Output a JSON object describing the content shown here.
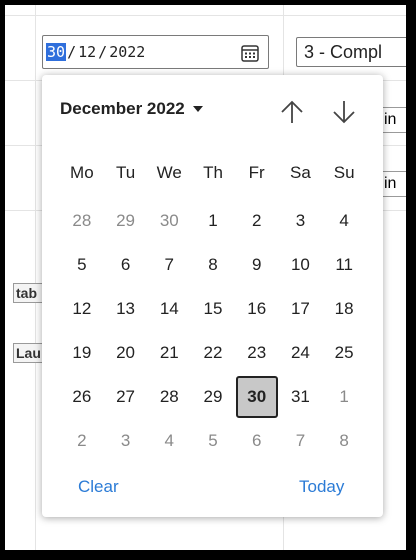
{
  "date_input": {
    "day": "30",
    "sep1": "/",
    "month": "12",
    "sep2": "/",
    "year": "2022"
  },
  "status_select": {
    "value": "3 - Compl"
  },
  "row_fields": [
    {
      "text": "in"
    },
    {
      "text": "in"
    }
  ],
  "side_buttons": [
    {
      "label": "tab"
    },
    {
      "label": "Lau"
    }
  ],
  "calendar": {
    "month_label": "December 2022",
    "weekdays": [
      "Mo",
      "Tu",
      "We",
      "Th",
      "Fr",
      "Sa",
      "Su"
    ],
    "days": [
      {
        "label": "28",
        "other": true
      },
      {
        "label": "29",
        "other": true
      },
      {
        "label": "30",
        "other": true
      },
      {
        "label": "1"
      },
      {
        "label": "2"
      },
      {
        "label": "3"
      },
      {
        "label": "4"
      },
      {
        "label": "5"
      },
      {
        "label": "6"
      },
      {
        "label": "7"
      },
      {
        "label": "8"
      },
      {
        "label": "9"
      },
      {
        "label": "10"
      },
      {
        "label": "11"
      },
      {
        "label": "12"
      },
      {
        "label": "13"
      },
      {
        "label": "14"
      },
      {
        "label": "15"
      },
      {
        "label": "16"
      },
      {
        "label": "17"
      },
      {
        "label": "18"
      },
      {
        "label": "19"
      },
      {
        "label": "20"
      },
      {
        "label": "21"
      },
      {
        "label": "22"
      },
      {
        "label": "23"
      },
      {
        "label": "24"
      },
      {
        "label": "25"
      },
      {
        "label": "26"
      },
      {
        "label": "27"
      },
      {
        "label": "28"
      },
      {
        "label": "29"
      },
      {
        "label": "30",
        "selected": true
      },
      {
        "label": "31"
      },
      {
        "label": "1",
        "other": true
      },
      {
        "label": "2",
        "other": true
      },
      {
        "label": "3",
        "other": true
      },
      {
        "label": "4",
        "other": true
      },
      {
        "label": "5",
        "other": true
      },
      {
        "label": "6",
        "other": true
      },
      {
        "label": "7",
        "other": true
      },
      {
        "label": "8",
        "other": true
      }
    ],
    "clear_label": "Clear",
    "today_label": "Today"
  },
  "colors": {
    "selection": "#2f6fdc",
    "link": "#2b7bd6",
    "selected_day_bg": "#c8c8c8"
  },
  "icons": {
    "calendar": "calendar-icon",
    "prev": "arrow-up-icon",
    "next": "arrow-down-icon",
    "dropdown": "caret-down-icon"
  }
}
